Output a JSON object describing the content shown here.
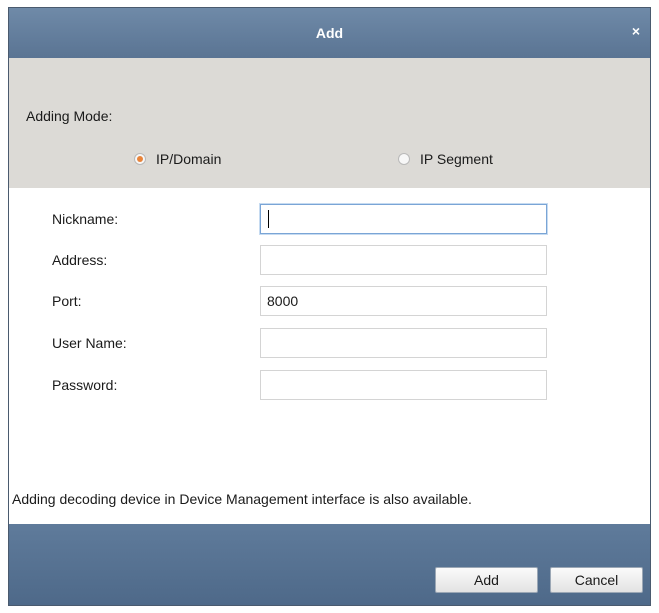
{
  "dialog": {
    "title": "Add",
    "close_icon": "×"
  },
  "adding_mode": {
    "label": "Adding Mode:",
    "options": [
      {
        "label": "IP/Domain",
        "selected": true
      },
      {
        "label": "IP Segment",
        "selected": false
      }
    ]
  },
  "form": {
    "nickname": {
      "label": "Nickname:",
      "value": ""
    },
    "address": {
      "label": "Address:",
      "value": ""
    },
    "port": {
      "label": "Port:",
      "value": "8000"
    },
    "user_name": {
      "label": "User Name:",
      "value": ""
    },
    "password": {
      "label": "Password:",
      "value": ""
    }
  },
  "info_text": "Adding decoding device in Device Management interface is also available.",
  "buttons": {
    "add": "Add",
    "cancel": "Cancel"
  },
  "colors": {
    "title_bar": "#5f7b9b",
    "mode_panel": "#dcdad6",
    "radio_selected": "#e8843b",
    "focus_border": "#7aa5d6"
  }
}
